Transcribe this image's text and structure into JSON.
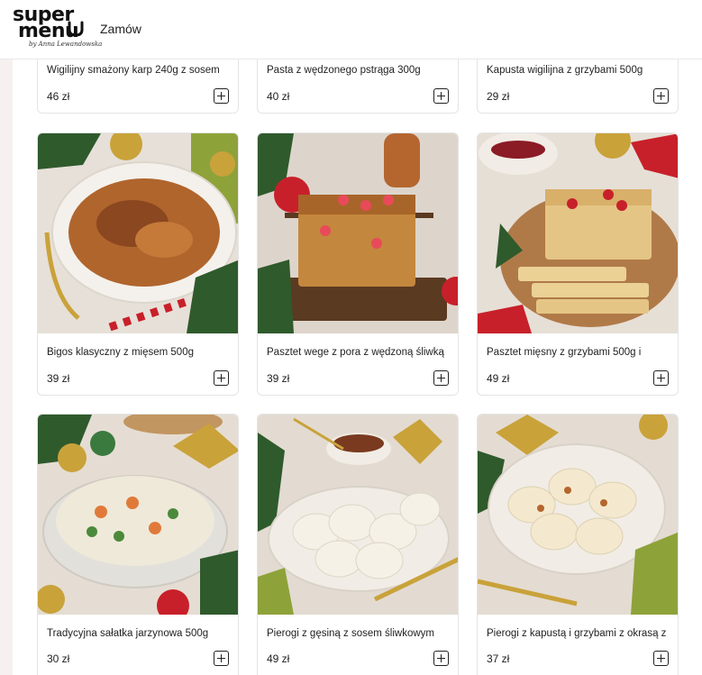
{
  "header": {
    "logo_top": "super",
    "logo_bottom": "menu",
    "logo_sub": "by Anna Lewandowska",
    "nav_order": "Zamów"
  },
  "products": [
    {
      "title": "Wigilijny smażony karp 240g z sosem",
      "price": "46 zł",
      "image": "none"
    },
    {
      "title": "Pasta z wędzonego pstrąga 300g",
      "price": "40 zł",
      "image": "none"
    },
    {
      "title": "Kapusta wigilijna z grzybami 500g",
      "price": "29 zł",
      "image": "none"
    },
    {
      "title": "Bigos klasyczny z mięsem 500g",
      "price": "39 zł",
      "image": "bigos-dish-photo"
    },
    {
      "title": "Pasztet wege z pora z wędzoną śliwką",
      "price": "39 zł",
      "image": "veggie-pate-photo"
    },
    {
      "title": "Pasztet mięsny z grzybami 500g i",
      "price": "49 zł",
      "image": "meat-pate-photo"
    },
    {
      "title": "Tradycyjna sałatka jarzynowa 500g",
      "price": "30 zł",
      "image": "vegetable-salad-photo"
    },
    {
      "title": "Pierogi z gęsiną z sosem śliwkowym",
      "price": "49 zł",
      "image": "goose-pierogi-photo"
    },
    {
      "title": "Pierogi z kapustą i grzybami z okrasą z",
      "price": "37 zł",
      "image": "cabbage-pierogi-photo"
    }
  ],
  "colors": {
    "card_border": "#e4e4e4",
    "photo_background": "#e9e2da",
    "accent_red": "#c8202a",
    "accent_gold": "#c9a23a",
    "pine_green": "#2f5a2c"
  }
}
